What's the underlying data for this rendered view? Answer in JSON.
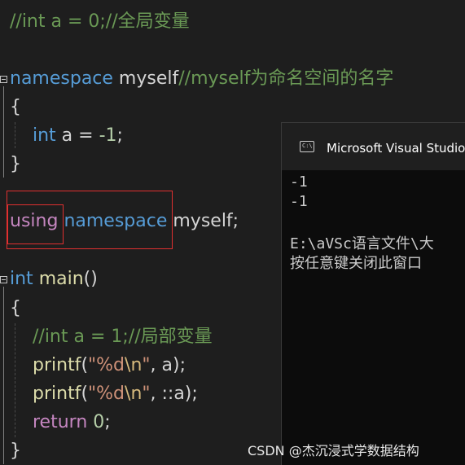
{
  "editor": {
    "line1": "//int a = 0;//全局变量",
    "ns_keyword": "namespace",
    "ns_name": " myself",
    "ns_comment": "//myself为命名空间的名字",
    "brace_open": "{",
    "brace_close": "}",
    "decl_type": "int",
    "decl_rest": " a = ",
    "decl_val": "-1",
    "semi": ";",
    "using_kw": "using",
    "using_ns_kw": "namespace",
    "using_rest": " myself;",
    "main_type": "int",
    "main_name": "main",
    "main_parens": "()",
    "local_comment": "//int a = 1;//局部变量",
    "printf": "printf",
    "paren_open": "(",
    "str_open": "\"%d",
    "esc": "\\n",
    "str_close": "\"",
    "printf1_args": ", a);",
    "printf2_args": ", ::a);",
    "return_kw": "return",
    "return_val": "0",
    "return_semi": ";"
  },
  "console": {
    "title": "Microsoft Visual Studio 调",
    "icon_text": "C:\\",
    "output": [
      "-1",
      "-1",
      "",
      "E:\\aVSc语言文件\\大",
      "按任意键关闭此窗口"
    ]
  },
  "watermark": "CSDN @杰沉浸式学数据结构",
  "colors": {
    "background": "#1e1e1e",
    "keyword": "#569cd6",
    "control": "#c586c0",
    "function": "#dcdcaa",
    "string": "#ce9178",
    "comment": "#6a9955",
    "number": "#b5cea8",
    "highlight_box": "#e03030"
  }
}
